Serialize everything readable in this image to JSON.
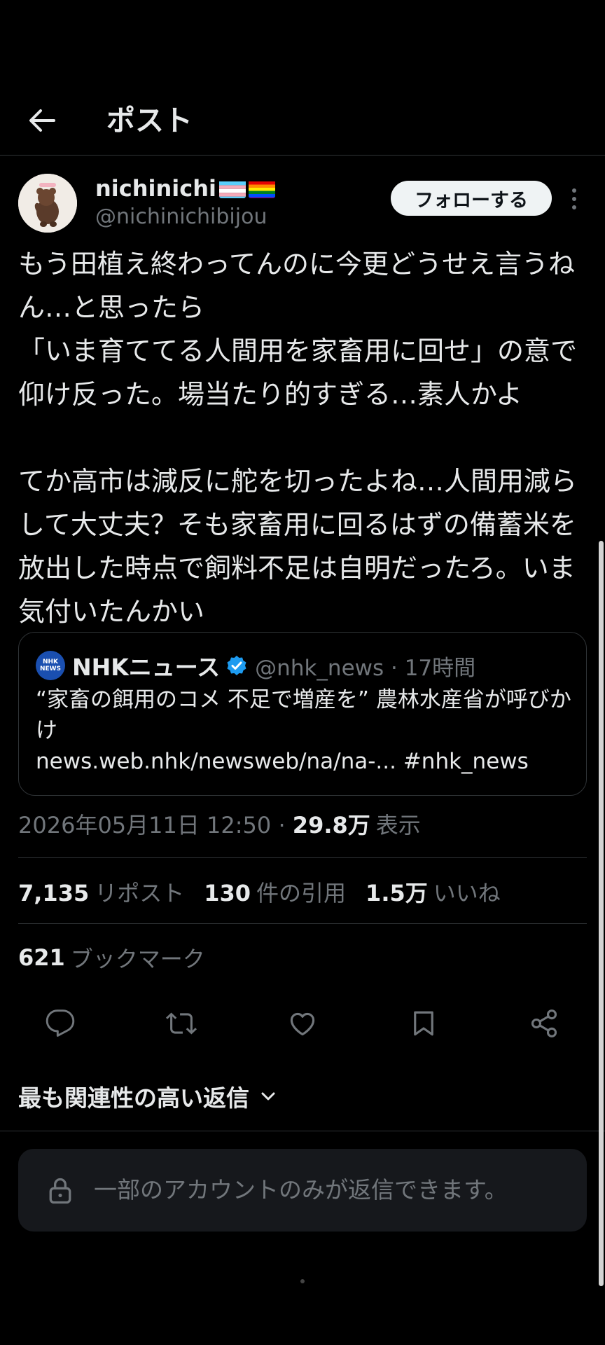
{
  "header": {
    "title": "ポスト",
    "back_icon": "arrow-left-icon"
  },
  "author": {
    "display_name": "nichinichi",
    "handle": "@nichinichibijou",
    "follow_label": "フォローする"
  },
  "post": {
    "text": "もう田植え終わってんのに今更どうせえ言うねん…と思ったら\n「いま育ててる人間用を家畜用に回せ」の意で仰け反った。場当たり的すぎる…素人かよ\n\nてか高市は減反に舵を切ったよね…人間用減らして大丈夫？そも家畜用に回るはずの備蓄米を放出した時点で飼料不足は自明だったろ。いま気付いたんかい"
  },
  "quote": {
    "logo_line1": "NHK",
    "logo_line2": "NEWS",
    "name": "NHKニュース",
    "handle_time": "@nhk_news · 17時間",
    "text": "“家畜の餌用のコメ 不足で増産を” 農林水産省が呼びかけ\nnews.web.nhk/newsweb/na/na-... #nhk_news"
  },
  "meta": {
    "datetime": "2026年05月11日 12:50 · ",
    "views_count": "29.8万",
    "views_label": "表示"
  },
  "stats": {
    "reposts_count": "7,135",
    "reposts_label": "リポスト",
    "quotes_count": "130",
    "quotes_label": "件の引用",
    "likes_count": "1.5万",
    "likes_label": "いいね",
    "bookmarks_count": "621",
    "bookmarks_label": "ブックマーク"
  },
  "actions": [
    "reply-icon",
    "repost-icon",
    "like-icon",
    "bookmark-icon",
    "share-icon"
  ],
  "replies": {
    "sort_label": "最も関連性の高い返信",
    "restricted_text": "一部のアカウントのみが返信できます。"
  },
  "colors": {
    "background": "#000000",
    "text": "#e7e9ea",
    "secondary": "#71767b",
    "border": "#2f3336",
    "verified": "#1d9bf0",
    "nhk_blue": "#1a4fb0"
  }
}
